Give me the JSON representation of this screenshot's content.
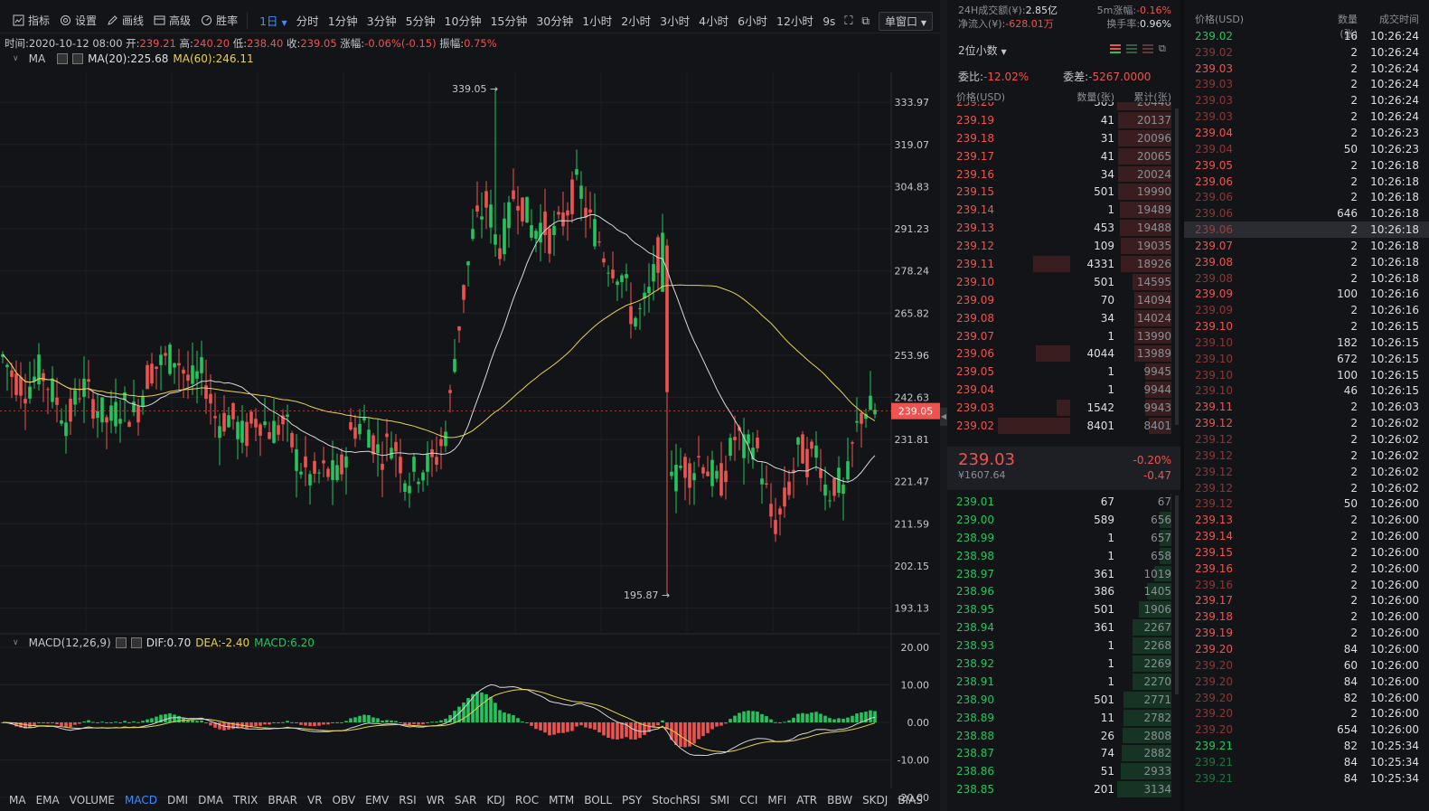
{
  "toolbar": {
    "indicator": "指标",
    "settings": "设置",
    "drawing": "画线",
    "advanced": "高级",
    "winrate": "胜率",
    "period_selected": "1日",
    "periods": [
      "分时",
      "1分钟",
      "3分钟",
      "5分钟",
      "10分钟",
      "15分钟",
      "30分钟",
      "1小时",
      "2小时",
      "3小时",
      "4小时",
      "6小时",
      "12小时"
    ],
    "refresh": "9s",
    "window_mode": "单窗口"
  },
  "info": {
    "time_label": "时间:",
    "time": "2020-10-12 08:00",
    "open_label": "开:",
    "open": "239.21",
    "high_label": "高:",
    "high": "240.20",
    "low_label": "低:",
    "low": "238.40",
    "close_label": "收:",
    "close": "239.05",
    "chg_label": "涨幅:",
    "chg": "-0.06%(-0.15)",
    "amp_label": "振幅:",
    "amp": "0.75%"
  },
  "ma": {
    "label": "MA",
    "ma20": "MA(20):225.68",
    "ma60": "MA(60):246.11"
  },
  "macd": {
    "label": "MACD(12,26,9)",
    "dif": "DIF:0.70",
    "dea": "DEA:-2.40",
    "macd": "MACD:6.20"
  },
  "chart_data": {
    "type": "candlestick",
    "price_axis": [
      "333.97",
      "319.07",
      "304.83",
      "291.23",
      "278.24",
      "265.82",
      "253.96",
      "242.63",
      "231.81",
      "221.47",
      "211.59",
      "202.15",
      "193.13"
    ],
    "price_ylim": [
      188,
      345
    ],
    "last_price": "239.05",
    "last_price_value": 239.05,
    "high_annotation": "339.05 →",
    "high_value": 339.05,
    "low_annotation": "195.87 →",
    "low_value": 195.87,
    "macd_axis": [
      "20.00",
      "10.00",
      "0.00",
      "-10.00",
      "-20.00"
    ],
    "macd_ylim": [
      -20,
      20
    ],
    "grid": true
  },
  "indicator_tabs": [
    "MA",
    "EMA",
    "VOLUME",
    "MACD",
    "DMI",
    "DMA",
    "TRIX",
    "BRAR",
    "VR",
    "OBV",
    "EMV",
    "RSI",
    "WR",
    "SAR",
    "KDJ",
    "ROC",
    "MTM",
    "BOLL",
    "PSY",
    "StochRSI",
    "SMI",
    "CCI",
    "MFI",
    "ATR",
    "BBW",
    "SKDJ",
    "BIAS"
  ],
  "indicator_active": "MACD",
  "book": {
    "vol24_label": "24H成交额(¥):",
    "vol24": "2.85亿",
    "m5_label": "5m涨幅:",
    "m5": "-0.16%",
    "netin_label": "净流入(¥):",
    "netin": "-628.01万",
    "turnover_label": "换手率:",
    "turnover": "0.96%",
    "decimals": "2位小数",
    "wb_label": "委比:",
    "wb": "-12.02%",
    "wd_label": "委差:",
    "wd": "-5267.0000",
    "col_price": "价格(USD)",
    "col_qty": "数量(张)",
    "col_total": "累计(张)",
    "asks": [
      [
        "239.20",
        "303",
        "20446"
      ],
      [
        "239.19",
        "41",
        "20137"
      ],
      [
        "239.18",
        "31",
        "20096"
      ],
      [
        "239.17",
        "41",
        "20065"
      ],
      [
        "239.16",
        "34",
        "20024"
      ],
      [
        "239.15",
        "501",
        "19990"
      ],
      [
        "239.14",
        "1",
        "19489"
      ],
      [
        "239.13",
        "453",
        "19488"
      ],
      [
        "239.12",
        "109",
        "19035"
      ],
      [
        "239.11",
        "4331",
        "18926"
      ],
      [
        "239.10",
        "501",
        "14595"
      ],
      [
        "239.09",
        "70",
        "14094"
      ],
      [
        "239.08",
        "34",
        "14024"
      ],
      [
        "239.07",
        "1",
        "13990"
      ],
      [
        "239.06",
        "4044",
        "13989"
      ],
      [
        "239.05",
        "1",
        "9945"
      ],
      [
        "239.04",
        "1",
        "9944"
      ],
      [
        "239.03",
        "1542",
        "9943"
      ],
      [
        "239.02",
        "8401",
        "8401"
      ]
    ],
    "mid_price": "239.03",
    "mid_cny": "¥1607.64",
    "mid_pct": "-0.20%",
    "mid_chg": "-0.47",
    "bids": [
      [
        "239.01",
        "67",
        "67"
      ],
      [
        "239.00",
        "589",
        "656"
      ],
      [
        "238.99",
        "1",
        "657"
      ],
      [
        "238.98",
        "1",
        "658"
      ],
      [
        "238.97",
        "361",
        "1019"
      ],
      [
        "238.96",
        "386",
        "1405"
      ],
      [
        "238.95",
        "501",
        "1906"
      ],
      [
        "238.94",
        "361",
        "2267"
      ],
      [
        "238.93",
        "1",
        "2268"
      ],
      [
        "238.92",
        "1",
        "2269"
      ],
      [
        "238.91",
        "1",
        "2270"
      ],
      [
        "238.90",
        "501",
        "2771"
      ],
      [
        "238.89",
        "11",
        "2782"
      ],
      [
        "238.88",
        "26",
        "2808"
      ],
      [
        "238.87",
        "74",
        "2882"
      ],
      [
        "238.86",
        "51",
        "2933"
      ],
      [
        "238.85",
        "201",
        "3134"
      ]
    ]
  },
  "trades": {
    "col_price": "价格(USD)",
    "col_qty": "数量(张)",
    "col_time": "成交时间",
    "rows": [
      [
        "239.02",
        "16",
        "10:26:24",
        "g",
        1
      ],
      [
        "239.02",
        "2",
        "10:26:24",
        "r",
        0
      ],
      [
        "239.03",
        "2",
        "10:26:24",
        "r",
        1
      ],
      [
        "239.03",
        "2",
        "10:26:24",
        "r",
        0
      ],
      [
        "239.03",
        "2",
        "10:26:24",
        "r",
        0
      ],
      [
        "239.03",
        "2",
        "10:26:24",
        "r",
        0
      ],
      [
        "239.04",
        "2",
        "10:26:23",
        "r",
        1
      ],
      [
        "239.04",
        "50",
        "10:26:23",
        "r",
        0
      ],
      [
        "239.05",
        "2",
        "10:26:18",
        "r",
        1
      ],
      [
        "239.06",
        "2",
        "10:26:18",
        "r",
        1
      ],
      [
        "239.06",
        "2",
        "10:26:18",
        "r",
        0
      ],
      [
        "239.06",
        "646",
        "10:26:18",
        "r",
        0
      ],
      [
        "239.06",
        "2",
        "10:26:18",
        "r",
        0
      ],
      [
        "239.07",
        "2",
        "10:26:18",
        "r",
        1
      ],
      [
        "239.08",
        "2",
        "10:26:18",
        "r",
        1
      ],
      [
        "239.08",
        "2",
        "10:26:18",
        "r",
        0
      ],
      [
        "239.09",
        "100",
        "10:26:16",
        "r",
        1
      ],
      [
        "239.09",
        "2",
        "10:26:16",
        "r",
        0
      ],
      [
        "239.10",
        "2",
        "10:26:15",
        "r",
        1
      ],
      [
        "239.10",
        "182",
        "10:26:15",
        "r",
        0
      ],
      [
        "239.10",
        "672",
        "10:26:15",
        "r",
        0
      ],
      [
        "239.10",
        "100",
        "10:26:15",
        "r",
        0
      ],
      [
        "239.10",
        "46",
        "10:26:15",
        "r",
        0
      ],
      [
        "239.11",
        "2",
        "10:26:03",
        "r",
        1
      ],
      [
        "239.12",
        "2",
        "10:26:02",
        "r",
        1
      ],
      [
        "239.12",
        "2",
        "10:26:02",
        "r",
        0
      ],
      [
        "239.12",
        "2",
        "10:26:02",
        "r",
        0
      ],
      [
        "239.12",
        "2",
        "10:26:02",
        "r",
        0
      ],
      [
        "239.12",
        "2",
        "10:26:02",
        "r",
        0
      ],
      [
        "239.12",
        "50",
        "10:26:00",
        "r",
        0
      ],
      [
        "239.13",
        "2",
        "10:26:00",
        "r",
        1
      ],
      [
        "239.14",
        "2",
        "10:26:00",
        "r",
        1
      ],
      [
        "239.15",
        "2",
        "10:26:00",
        "r",
        1
      ],
      [
        "239.16",
        "2",
        "10:26:00",
        "r",
        1
      ],
      [
        "239.16",
        "2",
        "10:26:00",
        "r",
        0
      ],
      [
        "239.17",
        "2",
        "10:26:00",
        "r",
        1
      ],
      [
        "239.18",
        "2",
        "10:26:00",
        "r",
        1
      ],
      [
        "239.19",
        "2",
        "10:26:00",
        "r",
        1
      ],
      [
        "239.20",
        "84",
        "10:26:00",
        "r",
        1
      ],
      [
        "239.20",
        "60",
        "10:26:00",
        "r",
        0
      ],
      [
        "239.20",
        "84",
        "10:26:00",
        "r",
        0
      ],
      [
        "239.20",
        "82",
        "10:26:00",
        "r",
        0
      ],
      [
        "239.20",
        "2",
        "10:26:00",
        "r",
        0
      ],
      [
        "239.20",
        "654",
        "10:26:00",
        "r",
        0
      ],
      [
        "239.21",
        "82",
        "10:25:34",
        "g",
        1
      ],
      [
        "239.21",
        "84",
        "10:25:34",
        "g",
        0
      ],
      [
        "239.21",
        "84",
        "10:25:34",
        "g",
        0
      ]
    ]
  },
  "colors": {
    "up": "#22c55e",
    "down": "#ef5350",
    "accent": "#3f8cff",
    "ma20": "#d8d8d8",
    "ma60": "#e8d34a",
    "bg": "#131417"
  }
}
